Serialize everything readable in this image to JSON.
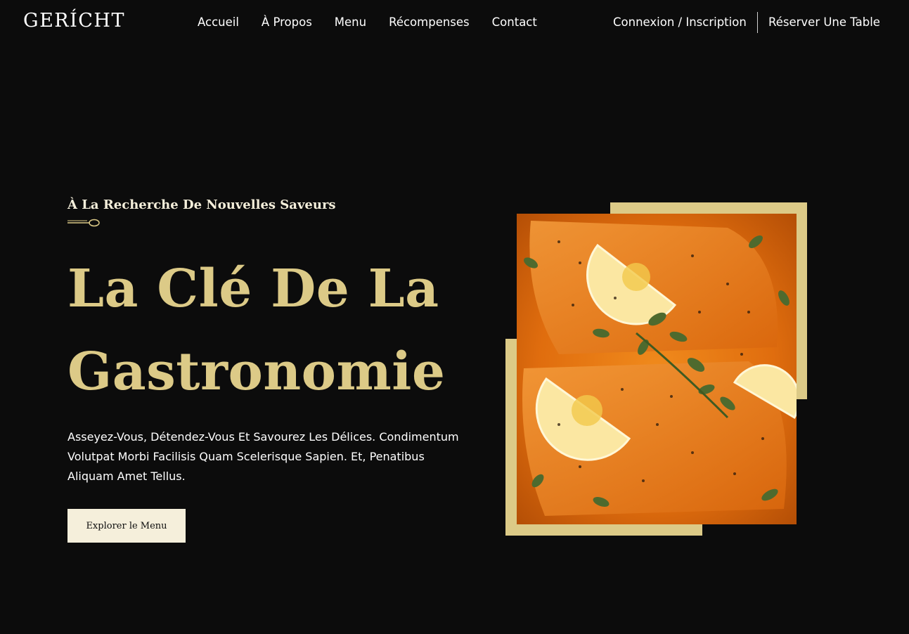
{
  "brand": {
    "logo_text": "GERÍCHT"
  },
  "nav": {
    "links": [
      "Accueil",
      "À Propos",
      "Menu",
      "Récompenses",
      "Contact"
    ]
  },
  "auth": {
    "login_label": "Connexion / Inscription",
    "reserve_label": "Réserver Une Table"
  },
  "hero": {
    "subtitle": "À La Recherche De Nouvelles Saveurs",
    "title_line1": "La Clé De La",
    "title_line2": "Gastronomie",
    "description": "Asseyez-Vous, Détendez-Vous Et Savourez Les Délices. Condimentum Volutpat Morbi Facilisis Quam Scelerisque Sapien. Et, Penatibus Aliquam Amet Tellus.",
    "cta_label": "Explorer le Menu"
  },
  "colors": {
    "background": "#0c0c0c",
    "accent_gold": "#dcca87",
    "cream": "#f5efdb",
    "text_white": "#ffffff"
  },
  "icons": {
    "spoon": "spoon-icon"
  }
}
